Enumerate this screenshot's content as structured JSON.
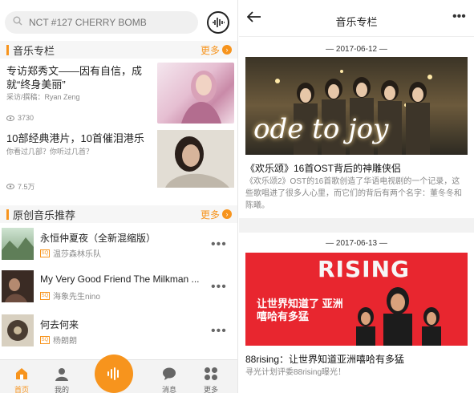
{
  "left": {
    "search": {
      "placeholder": "NCT #127 CHERRY BOMB"
    },
    "column_section": {
      "title": "音乐专栏",
      "more": "更多"
    },
    "articles": [
      {
        "title": "专访郑秀文——因有自信，成就“终身美丽”",
        "sub": "采访/撰稿：Ryan Zeng",
        "views": "3730"
      },
      {
        "title": "10部经典港片，10首催泪港乐",
        "sub": "你看过几部？你听过几首？",
        "views": "7.5万"
      }
    ],
    "original_section": {
      "title": "原创音乐推荐",
      "more": "更多"
    },
    "songs": [
      {
        "name": "永恒仲夏夜（全新混缩版）",
        "artist": "温莎森林乐队"
      },
      {
        "name": "My Very Good Friend The Milkman ...",
        "artist": "海象先生nino"
      },
      {
        "name": "何去何来",
        "artist": "杨朗朗"
      }
    ],
    "tabs": [
      {
        "label": "首页",
        "icon": "home-icon"
      },
      {
        "label": "我的",
        "icon": "user-icon"
      },
      {
        "label": "消息",
        "icon": "chat-icon"
      },
      {
        "label": "更多",
        "icon": "grid-icon"
      }
    ],
    "colors": {
      "accent": "#f7941d"
    }
  },
  "right": {
    "header": {
      "title": "音乐专栏"
    },
    "posts": [
      {
        "date": "— 2017-06-12 —",
        "title": "《欢乐颂》16首OST背后的神雕侠侣",
        "desc": "《欢乐颂2》OST的16首歌创造了华语电视剧的一个记录，这些歌唱进了很多人心里，而它们的背后有两个名字：董冬冬和陈曦。",
        "banner_text": "ode to joy"
      },
      {
        "date": "— 2017-06-13 —",
        "title": "88rising：让世界知道亚洲嘻哈有多猛",
        "desc": "寻光计划评委88rising曝光！",
        "banner_text": "RISING",
        "banner_tagline": "让世界知道了 亚洲嘻哈有多猛"
      }
    ]
  }
}
